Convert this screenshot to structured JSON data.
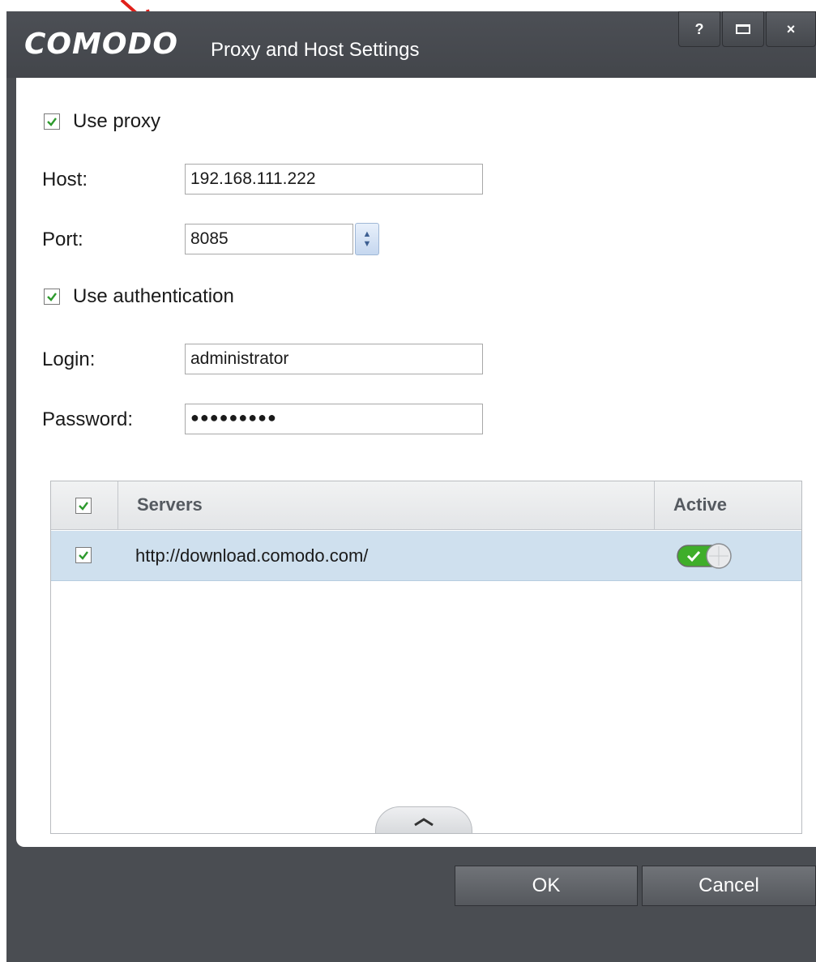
{
  "window": {
    "brand": "COMODO",
    "title": "Proxy and Host Settings",
    "buttons": {
      "help": "?",
      "close": "×"
    }
  },
  "proxy": {
    "use_proxy_label": "Use proxy",
    "use_proxy_checked": true,
    "host_label": "Host:",
    "host_value": "192.168.111.222",
    "port_label": "Port:",
    "port_value": "8085",
    "use_auth_label": "Use authentication",
    "use_auth_checked": true,
    "login_label": "Login:",
    "login_value": "administrator",
    "password_label": "Password:",
    "password_value": "●●●●●●●●●"
  },
  "servers": {
    "columns": [
      "Servers",
      "Active"
    ],
    "rows": [
      {
        "checked": true,
        "url": "http://download.comodo.com/",
        "active": true
      }
    ]
  },
  "footer": {
    "ok_label": "OK",
    "cancel_label": "Cancel"
  },
  "colors": {
    "checkmark": "#2d9a2d",
    "toggle_on": "#3fae2a",
    "selected_row": "#cfe0ee",
    "annotation_arrow": "#e0201a"
  },
  "icons": {
    "help": "question-icon",
    "maximize": "maximize-icon",
    "close": "close-icon",
    "spinner": "spin-up-down-icon",
    "expand": "chevron-up-icon"
  }
}
